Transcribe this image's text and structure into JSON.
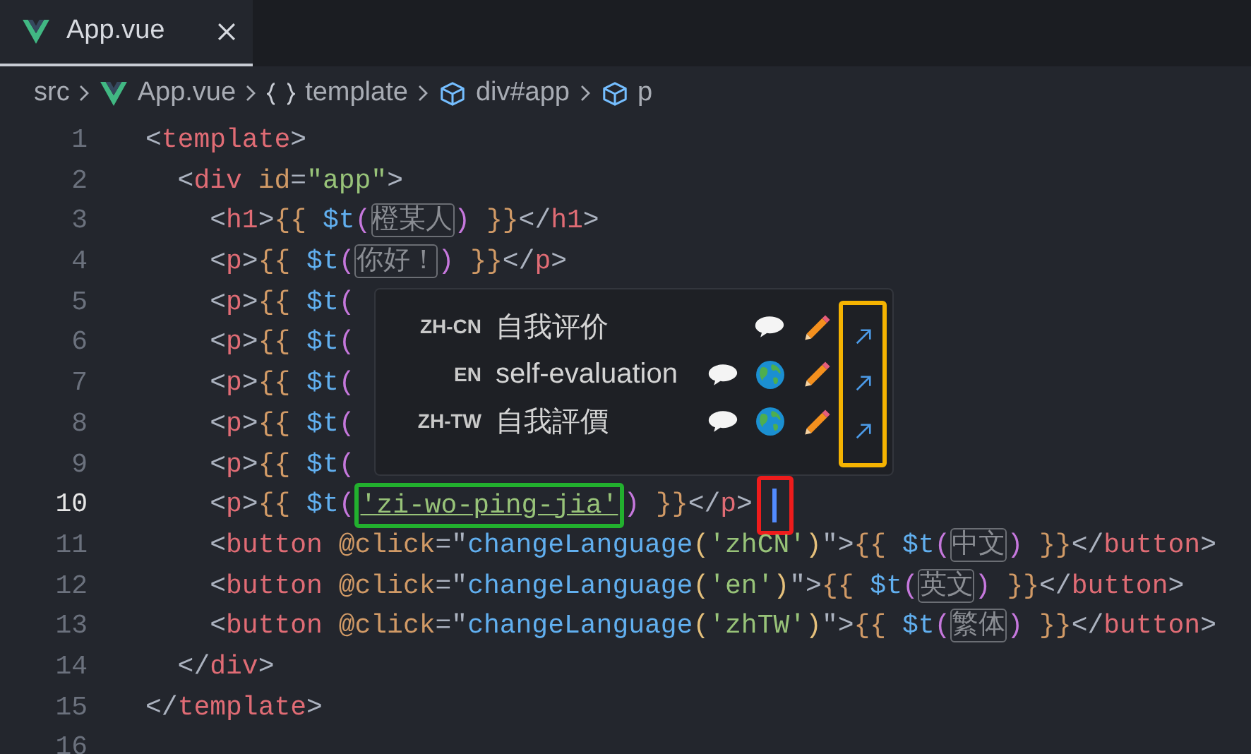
{
  "tab": {
    "label": "App.vue",
    "selected": true
  },
  "breadcrumb": [
    {
      "kind": "plain",
      "label": "src"
    },
    {
      "kind": "vue",
      "label": "App.vue"
    },
    {
      "kind": "braces",
      "label": "template"
    },
    {
      "kind": "cube",
      "label": "div#app"
    },
    {
      "kind": "cube",
      "label": "p"
    }
  ],
  "lines": [
    {
      "number": "1",
      "current": false,
      "tokens": [
        {
          "kind": "p",
          "text": "<"
        },
        {
          "kind": "tag",
          "text": "template"
        },
        {
          "kind": "p",
          "text": ">"
        }
      ]
    },
    {
      "number": "2",
      "current": false,
      "tokens": [
        {
          "kind": "p",
          "text": "  <"
        },
        {
          "kind": "tag",
          "text": "div"
        },
        {
          "kind": "attr",
          "text": " id"
        },
        {
          "kind": "p",
          "text": "="
        },
        {
          "kind": "str",
          "text": "\"app\""
        },
        {
          "kind": "p",
          "text": ">"
        }
      ]
    },
    {
      "number": "3",
      "current": false,
      "tokens": [
        {
          "kind": "p",
          "text": "    <"
        },
        {
          "kind": "tag",
          "text": "h1"
        },
        {
          "kind": "p",
          "text": ">"
        },
        {
          "kind": "brace",
          "text": "{{ "
        },
        {
          "kind": "fn",
          "text": "$t"
        },
        {
          "kind": "paren",
          "text": "("
        },
        {
          "kind": "hint",
          "text": "橙某人"
        },
        {
          "kind": "paren",
          "text": ")"
        },
        {
          "kind": "brace",
          "text": " }}"
        },
        {
          "kind": "p",
          "text": "</"
        },
        {
          "kind": "tag",
          "text": "h1"
        },
        {
          "kind": "p",
          "text": ">"
        }
      ]
    },
    {
      "number": "4",
      "current": false,
      "tokens": [
        {
          "kind": "p",
          "text": "    <"
        },
        {
          "kind": "tag",
          "text": "p"
        },
        {
          "kind": "p",
          "text": ">"
        },
        {
          "kind": "brace",
          "text": "{{ "
        },
        {
          "kind": "fn",
          "text": "$t"
        },
        {
          "kind": "paren",
          "text": "("
        },
        {
          "kind": "hint",
          "text": "你好！"
        },
        {
          "kind": "paren",
          "text": ")"
        },
        {
          "kind": "brace",
          "text": " }}"
        },
        {
          "kind": "p",
          "text": "</"
        },
        {
          "kind": "tag",
          "text": "p"
        },
        {
          "kind": "p",
          "text": ">"
        }
      ]
    },
    {
      "number": "5",
      "current": false,
      "tokens": [
        {
          "kind": "p",
          "text": "    <"
        },
        {
          "kind": "tag",
          "text": "p"
        },
        {
          "kind": "p",
          "text": ">"
        },
        {
          "kind": "brace",
          "text": "{{ "
        },
        {
          "kind": "fn",
          "text": "$t"
        },
        {
          "kind": "paren",
          "text": "("
        }
      ]
    },
    {
      "number": "6",
      "current": false,
      "tokens": [
        {
          "kind": "p",
          "text": "    <"
        },
        {
          "kind": "tag",
          "text": "p"
        },
        {
          "kind": "p",
          "text": ">"
        },
        {
          "kind": "brace",
          "text": "{{ "
        },
        {
          "kind": "fn",
          "text": "$t"
        },
        {
          "kind": "paren",
          "text": "("
        }
      ]
    },
    {
      "number": "7",
      "current": false,
      "tokens": [
        {
          "kind": "p",
          "text": "    <"
        },
        {
          "kind": "tag",
          "text": "p"
        },
        {
          "kind": "p",
          "text": ">"
        },
        {
          "kind": "brace",
          "text": "{{ "
        },
        {
          "kind": "fn",
          "text": "$t"
        },
        {
          "kind": "paren",
          "text": "("
        }
      ]
    },
    {
      "number": "8",
      "current": false,
      "tokens": [
        {
          "kind": "p",
          "text": "    <"
        },
        {
          "kind": "tag",
          "text": "p"
        },
        {
          "kind": "p",
          "text": ">"
        },
        {
          "kind": "brace",
          "text": "{{ "
        },
        {
          "kind": "fn",
          "text": "$t"
        },
        {
          "kind": "paren",
          "text": "("
        }
      ]
    },
    {
      "number": "9",
      "current": false,
      "tokens": [
        {
          "kind": "p",
          "text": "    <"
        },
        {
          "kind": "tag",
          "text": "p"
        },
        {
          "kind": "p",
          "text": ">"
        },
        {
          "kind": "brace",
          "text": "{{ "
        },
        {
          "kind": "fn",
          "text": "$t"
        },
        {
          "kind": "paren",
          "text": "("
        }
      ]
    },
    {
      "number": "10",
      "current": true,
      "cursor": true,
      "tokens": [
        {
          "kind": "p",
          "text": "    <"
        },
        {
          "kind": "tag",
          "text": "p"
        },
        {
          "kind": "p",
          "text": ">"
        },
        {
          "kind": "brace",
          "text": "{{ "
        },
        {
          "kind": "fn",
          "text": "$t"
        },
        {
          "kind": "paren",
          "text": "("
        },
        {
          "kind": "marked",
          "text": "'zi-wo-ping-jia'"
        },
        {
          "kind": "paren",
          "text": ")"
        },
        {
          "kind": "brace",
          "text": " }}"
        },
        {
          "kind": "p",
          "text": "</"
        },
        {
          "kind": "tag",
          "text": "p"
        },
        {
          "kind": "p",
          "text": ">"
        }
      ]
    },
    {
      "number": "11",
      "current": false,
      "tokens": [
        {
          "kind": "p",
          "text": "    <"
        },
        {
          "kind": "tag",
          "text": "button"
        },
        {
          "kind": "attr",
          "text": " @click"
        },
        {
          "kind": "p",
          "text": "=\""
        },
        {
          "kind": "fn",
          "text": "changeLanguage"
        },
        {
          "kind": "yparen",
          "text": "("
        },
        {
          "kind": "str",
          "text": "'zhCN'"
        },
        {
          "kind": "yparen",
          "text": ")"
        },
        {
          "kind": "p",
          "text": "\">"
        },
        {
          "kind": "brace",
          "text": "{{ "
        },
        {
          "kind": "fn",
          "text": "$t"
        },
        {
          "kind": "paren",
          "text": "("
        },
        {
          "kind": "hint",
          "text": "中文"
        },
        {
          "kind": "paren",
          "text": ")"
        },
        {
          "kind": "brace",
          "text": " }}"
        },
        {
          "kind": "p",
          "text": "</"
        },
        {
          "kind": "tag",
          "text": "button"
        },
        {
          "kind": "p",
          "text": ">"
        }
      ]
    },
    {
      "number": "12",
      "current": false,
      "tokens": [
        {
          "kind": "p",
          "text": "    <"
        },
        {
          "kind": "tag",
          "text": "button"
        },
        {
          "kind": "attr",
          "text": " @click"
        },
        {
          "kind": "p",
          "text": "=\""
        },
        {
          "kind": "fn",
          "text": "changeLanguage"
        },
        {
          "kind": "yparen",
          "text": "("
        },
        {
          "kind": "str",
          "text": "'en'"
        },
        {
          "kind": "yparen",
          "text": ")"
        },
        {
          "kind": "p",
          "text": "\">"
        },
        {
          "kind": "brace",
          "text": "{{ "
        },
        {
          "kind": "fn",
          "text": "$t"
        },
        {
          "kind": "paren",
          "text": "("
        },
        {
          "kind": "hint",
          "text": "英文"
        },
        {
          "kind": "paren",
          "text": ")"
        },
        {
          "kind": "brace",
          "text": " }}"
        },
        {
          "kind": "p",
          "text": "</"
        },
        {
          "kind": "tag",
          "text": "button"
        },
        {
          "kind": "p",
          "text": ">"
        }
      ]
    },
    {
      "number": "13",
      "current": false,
      "tokens": [
        {
          "kind": "p",
          "text": "    <"
        },
        {
          "kind": "tag",
          "text": "button"
        },
        {
          "kind": "attr",
          "text": " @click"
        },
        {
          "kind": "p",
          "text": "=\""
        },
        {
          "kind": "fn",
          "text": "changeLanguage"
        },
        {
          "kind": "yparen",
          "text": "("
        },
        {
          "kind": "str",
          "text": "'zhTW'"
        },
        {
          "kind": "yparen",
          "text": ")"
        },
        {
          "kind": "p",
          "text": "\">"
        },
        {
          "kind": "brace",
          "text": "{{ "
        },
        {
          "kind": "fn",
          "text": "$t"
        },
        {
          "kind": "paren",
          "text": "("
        },
        {
          "kind": "hint",
          "text": "繁体"
        },
        {
          "kind": "paren",
          "text": ")"
        },
        {
          "kind": "brace",
          "text": " }}"
        },
        {
          "kind": "p",
          "text": "</"
        },
        {
          "kind": "tag",
          "text": "button"
        },
        {
          "kind": "p",
          "text": ">"
        }
      ]
    },
    {
      "number": "14",
      "current": false,
      "tokens": [
        {
          "kind": "p",
          "text": "  </"
        },
        {
          "kind": "tag",
          "text": "div"
        },
        {
          "kind": "p",
          "text": ">"
        }
      ]
    },
    {
      "number": "15",
      "current": false,
      "tokens": [
        {
          "kind": "p",
          "text": "</"
        },
        {
          "kind": "tag",
          "text": "template"
        },
        {
          "kind": "p",
          "text": ">"
        }
      ]
    },
    {
      "number": "16",
      "current": false
    }
  ],
  "popup": {
    "arrows_framed": true,
    "rows": [
      {
        "locale": "ZH-CN",
        "text": "自我评价",
        "globe": false
      },
      {
        "locale": "EN",
        "text": "self-evaluation",
        "globe": true
      },
      {
        "locale": "ZH-TW",
        "text": "自我評價",
        "globe": true
      }
    ]
  }
}
